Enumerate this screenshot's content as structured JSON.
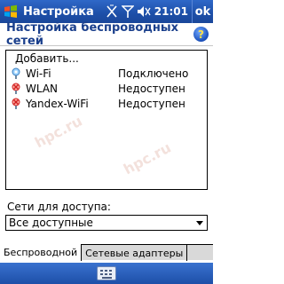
{
  "titlebar": {
    "title": "Настройка",
    "clock": "21:01",
    "ok_label": "ok"
  },
  "header": {
    "title": "Настройка беспроводных сетей",
    "help_label": "?"
  },
  "network_list": {
    "add_label": "Добавить...",
    "items": [
      {
        "name": "Wi-Fi",
        "status": "Подключено",
        "icon": "wifi-connected-icon"
      },
      {
        "name": "WLAN",
        "status": "Недоступен",
        "icon": "wifi-unavailable-icon"
      },
      {
        "name": "Yandex-WiFi",
        "status": "Недоступен",
        "icon": "wifi-unavailable-icon"
      }
    ]
  },
  "access": {
    "label": "Сети для доступа:",
    "selected": "Все доступные"
  },
  "tabs": [
    {
      "label": "Беспроводной",
      "active": true
    },
    {
      "label": "Сетевые адаптеры",
      "active": false
    }
  ],
  "watermark": "hpc.ru",
  "colors": {
    "titlebar": "#1d4fa8",
    "header_text": "#1a3f8c",
    "unavailable_red": "#d02020"
  }
}
